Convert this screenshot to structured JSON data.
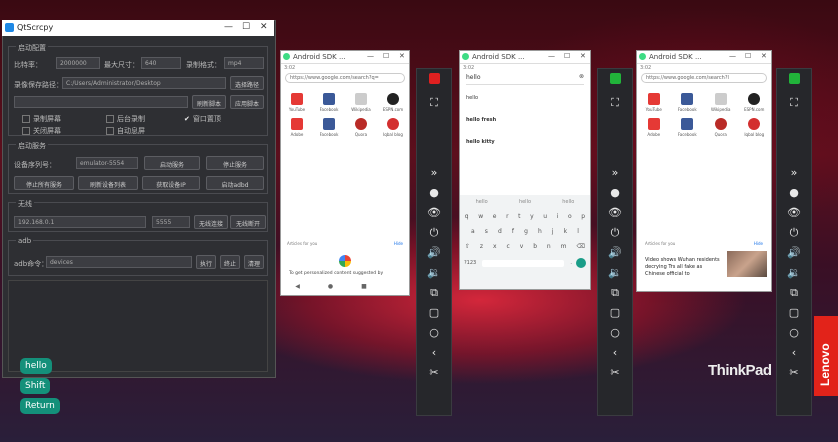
{
  "qtscrcpy": {
    "title": "QtScrcpy",
    "window_controls": [
      "—",
      "☐",
      "✕"
    ],
    "config_group": "启动配置",
    "bitrate_label": "比特率：",
    "bitrate_value": "2000000",
    "max_size_label": "最大尺寸：",
    "max_size_value": "640",
    "record_format_label": "录制格式：",
    "record_format_value": "mp4",
    "record_path_label": "录像保存路径：",
    "record_path_value": "C:/Users/Administrator/Desktop",
    "select_path_button": "选择路径",
    "refresh_script_button": "刷新脚本",
    "apply_script_button": "应用脚本",
    "options": [
      {
        "label": "录制屏幕",
        "checked": false
      },
      {
        "label": "后台录制",
        "checked": false
      },
      {
        "label": "窗口置顶",
        "checked": true
      },
      {
        "label": "关闭屏幕",
        "checked": false
      },
      {
        "label": "自动息屏",
        "checked": false
      }
    ],
    "start_group": "启动服务",
    "device_sn_label": "设备序列号：",
    "device_sn_value": "emulator-5554",
    "start_service_button": "启动服务",
    "stop_service_button": "停止服务",
    "stop_all_button": "停止所有服务",
    "refresh_devices_button": "刷新设备列表",
    "get_ip_button": "获取设备IP",
    "start_adbd_button": "启动adbd",
    "wireless_group": "无线",
    "ip_value": "192.168.0.1",
    "port_value": "5555",
    "wireless_connect_button": "无线连接",
    "wireless_disconnect_button": "无线断开",
    "adb_group": "adb",
    "adb_cmd_label": "adb命令：",
    "adb_cmd_value": "devices",
    "execute_button": "执行",
    "terminate_button": "终止",
    "clear_button": "清理"
  },
  "phone1": {
    "title": "Android SDK ...",
    "window_controls": [
      "—",
      "☐",
      "✕"
    ],
    "status_time": "3:02",
    "url": "https://www.google.com/search?q=",
    "tiles": [
      {
        "label": "YouTube",
        "color": "#e53935"
      },
      {
        "label": "Facebook",
        "color": "#3b5998"
      },
      {
        "label": "Wikipedia",
        "color": "#cccccc"
      },
      {
        "label": "ESPN.com",
        "color": "#222222"
      },
      {
        "label": "Adobe",
        "color": "#e53935"
      },
      {
        "label": "Facebook",
        "color": "#3b5998"
      },
      {
        "label": "Quora",
        "color": "#b92b27"
      },
      {
        "label": "Iqbal blog",
        "color": "#d32f2f"
      }
    ],
    "articles_label": "Articles for you",
    "hide_label": "Hide",
    "personalized_text": "To get personalized content suggested by"
  },
  "phone2": {
    "title": "Android SDK ...",
    "window_controls": [
      "—",
      "☐",
      "✕"
    ],
    "status_time": "3:02",
    "query": "hello",
    "suggestions": [
      "hello",
      "hello fresh",
      "hello kitty"
    ],
    "keyboard_suggestions": [
      "hello",
      "hello",
      "hello"
    ],
    "keyboard_rows": [
      [
        "q",
        "w",
        "e",
        "r",
        "t",
        "y",
        "u",
        "i",
        "o",
        "p"
      ],
      [
        "a",
        "s",
        "d",
        "f",
        "g",
        "h",
        "j",
        "k",
        "l"
      ],
      [
        "⇧",
        "z",
        "x",
        "c",
        "v",
        "b",
        "n",
        "m",
        "⌫"
      ]
    ],
    "kb_bottom_left": "?123",
    "kb_bottom_period": "."
  },
  "phone3": {
    "title": "Android SDK ...",
    "window_controls": [
      "—",
      "☐",
      "✕"
    ],
    "status_time": "3:02",
    "url": "https://www.google.com/search?l",
    "tiles": [
      {
        "label": "YouTube",
        "color": "#e53935"
      },
      {
        "label": "Facebook",
        "color": "#3b5998"
      },
      {
        "label": "Wikipedia",
        "color": "#cccccc"
      },
      {
        "label": "ESPN.com",
        "color": "#222222"
      },
      {
        "label": "Adobe",
        "color": "#e53935"
      },
      {
        "label": "Facebook",
        "color": "#3b5998"
      },
      {
        "label": "Quora",
        "color": "#b92b27"
      },
      {
        "label": "Iqbal blog",
        "color": "#d32f2f"
      }
    ],
    "articles_label": "Articles for you",
    "hide_label": "Hide",
    "news_title": "Video shows Wuhan residents decrying Trs all fake as Chinese official to"
  },
  "toolbars": [
    {
      "accent": "#e02020"
    },
    {
      "accent": "#21b43a"
    },
    {
      "accent": "#21b43a"
    }
  ],
  "toolbar_icons": [
    "full-screen",
    "expand-notification",
    "touch",
    "eye",
    "power",
    "volume-up",
    "volume-down",
    "app-switch",
    "menu",
    "home",
    "back",
    "screenshot"
  ],
  "toolbar_glyphs": [
    "⛶",
    "»",
    "●",
    "👁",
    "⏻",
    "🔊",
    "🔉",
    "⧉",
    "▢",
    "○",
    "‹",
    "✂"
  ],
  "keymap_buttons": [
    "hello",
    "Shift",
    "Return"
  ],
  "branding": {
    "thinkpad": "ThinkPad",
    "lenovo": "Lenovo"
  }
}
